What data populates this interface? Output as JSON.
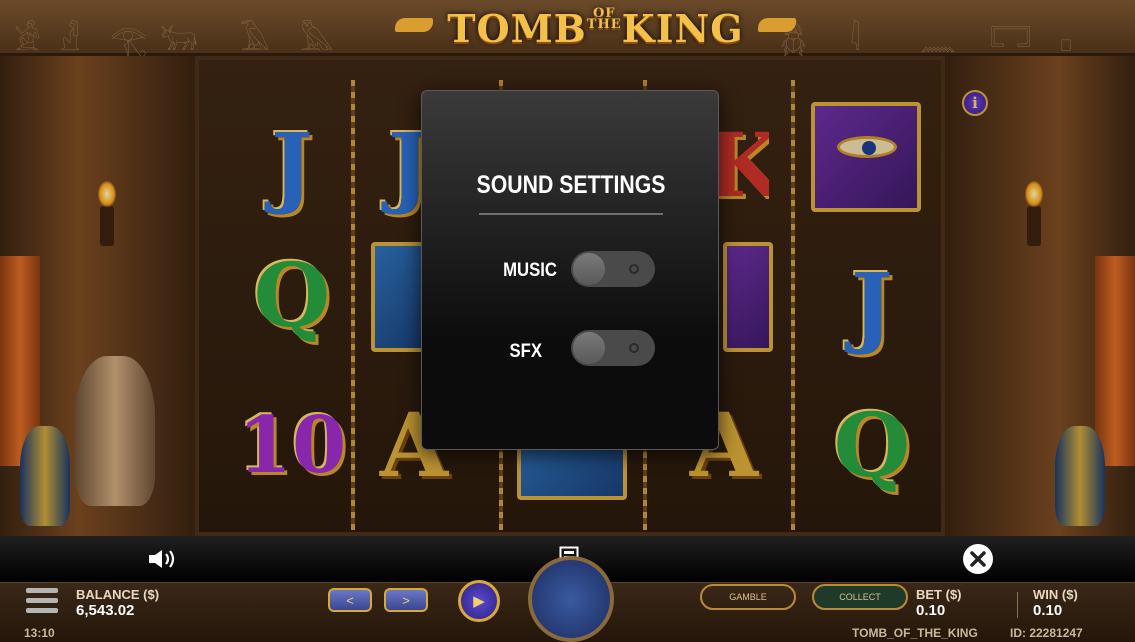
{
  "game": {
    "logo_main": "TOMB",
    "logo_of": "OF",
    "logo_the": "THE",
    "logo_king": "KING",
    "info_label": "i"
  },
  "reels": {
    "symbols_visible": [
      "J",
      "Q",
      "10",
      "J",
      "A",
      "A",
      "K",
      "A",
      "J",
      "Q"
    ]
  },
  "sound_settings": {
    "title": "SOUND SETTINGS",
    "music_label": "MUSIC",
    "music_on": false,
    "sfx_label": "SFX",
    "sfx_on": false
  },
  "toolbar": {
    "sound_icon": "speaker-icon",
    "paytable_icon": "paytable-icon",
    "close_icon": "close-icon"
  },
  "status": {
    "balance_label": "BALANCE ($)",
    "balance_value": "6,543.02",
    "time": "13:10",
    "gamble_label": "GAMBLE",
    "collect_label": "COLLECT",
    "bet_label": "BET ($)",
    "bet_value": "0.10",
    "win_label": "WIN ($)",
    "win_value": "0.10",
    "game_id_name": "TOMB_OF_THE_KING",
    "round_id": "ID: 22281247",
    "prev_arrow": "<",
    "next_arrow": ">",
    "play_glyph": "▶"
  },
  "colors": {
    "logo_gold": "#f3c04a",
    "modal_bg": "#1e1e1e",
    "toggle_off": "#4a4a4a"
  }
}
